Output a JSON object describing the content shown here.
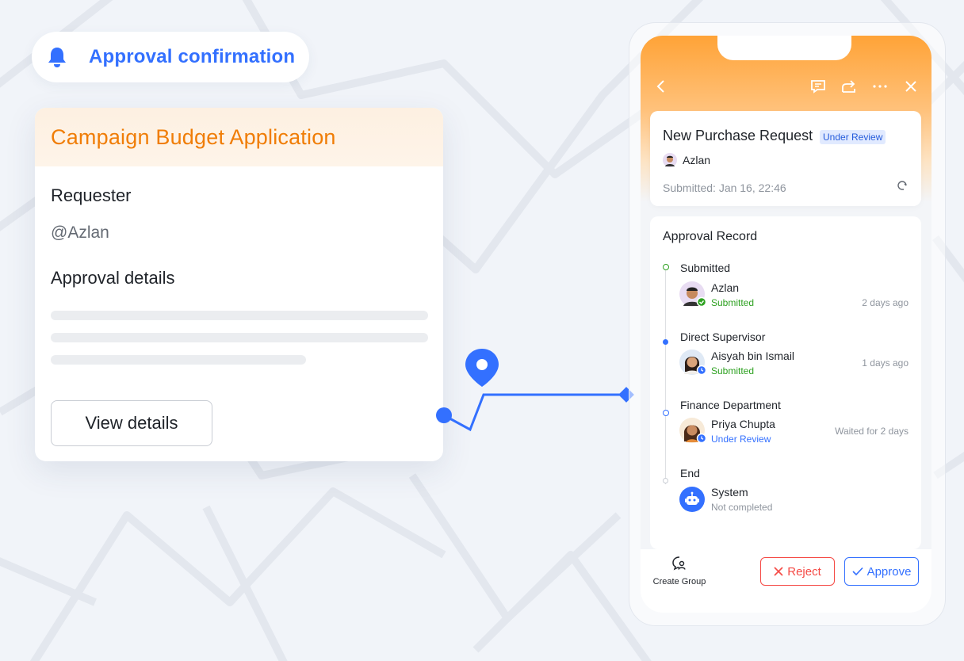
{
  "notification": {
    "title": "Approval confirmation",
    "icon": "bell-icon"
  },
  "left_card": {
    "title": "Campaign Budget Application",
    "requester_label": "Requester",
    "requester_value": "@Azlan",
    "details_label": "Approval details",
    "view_button": "View details"
  },
  "phone": {
    "toolbar_icons": [
      "back-icon",
      "comment-icon",
      "share-icon",
      "more-icon",
      "close-icon"
    ],
    "request": {
      "title": "New Purchase Request",
      "status_badge": "Under Review",
      "user": "Azlan",
      "submitted": "Submitted: Jan 16, 22:46"
    },
    "record": {
      "title": "Approval Record",
      "steps": [
        {
          "step": "Submitted",
          "name": "Azlan",
          "status": "Submitted",
          "time": "2 days ago"
        },
        {
          "step": "Direct Supervisor",
          "name": "Aisyah bin Ismail",
          "status": "Submitted",
          "time": "1 days ago"
        },
        {
          "step": "Finance Department",
          "name": "Priya Chupta",
          "status": "Under Review",
          "time": "Waited for 2 days"
        },
        {
          "step": "End",
          "name": "System",
          "status": "Not completed",
          "time": ""
        }
      ]
    },
    "bottom": {
      "create_group": "Create Group",
      "reject": "Reject",
      "approve": "Approve"
    }
  },
  "colors": {
    "accent_blue": "#3370ff",
    "header_orange": "#f07d06",
    "reject_red": "#f54a45",
    "success_green": "#2ea121"
  }
}
